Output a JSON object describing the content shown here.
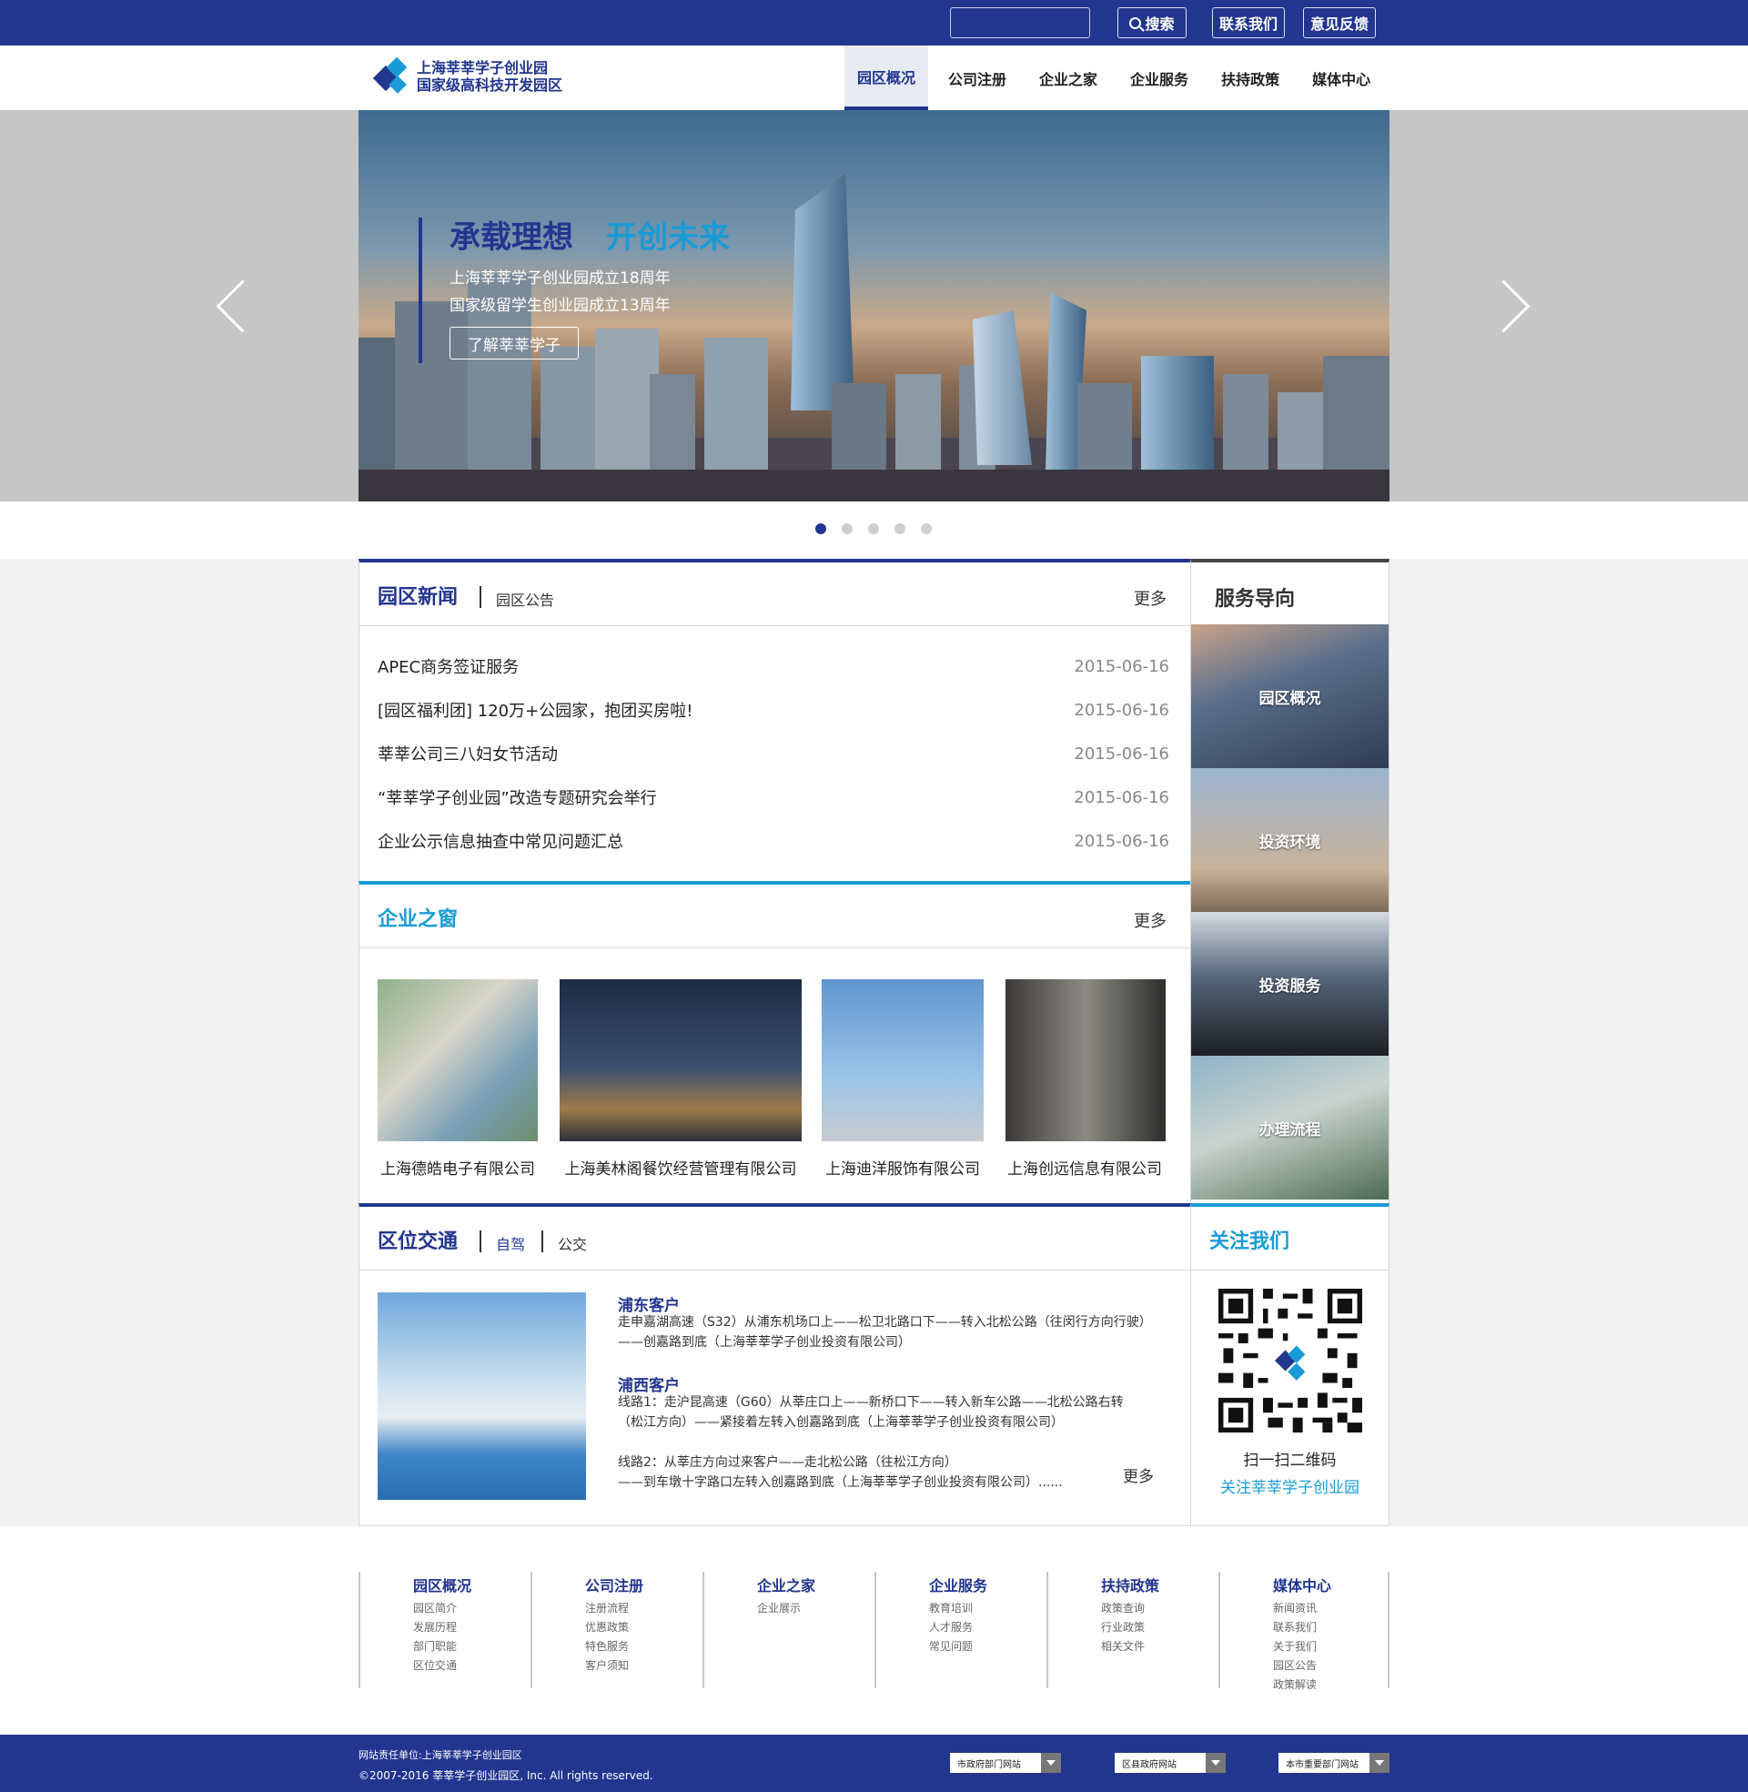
{
  "topbar": {
    "search_placeholder": "",
    "search_label": "搜索",
    "contact_label": "联系我们",
    "feedback_label": "意见反馈"
  },
  "logo": {
    "line1": "上海莘莘学子创业园",
    "line2": "国家级高科技开发园区"
  },
  "nav": {
    "items": [
      "园区概况",
      "公司注册",
      "企业之家",
      "企业服务",
      "扶持政策",
      "媒体中心"
    ],
    "active_index": 0
  },
  "banner": {
    "slogan_a": "承载理想",
    "slogan_b": "开创未来",
    "line1": "上海莘莘学子创业园成立18周年",
    "line2": "国家级留学生创业园成立13周年",
    "button": "了解莘莘学子",
    "slides": 5,
    "active_slide": 1
  },
  "news": {
    "title": "园区新闻",
    "tab2": "园区公告",
    "more": "更多",
    "items": [
      {
        "title": "APEC商务签证服务",
        "date": "2015-06-16"
      },
      {
        "title": "[园区福利团] 120万+公园家，抱团买房啦!",
        "date": "2015-06-16"
      },
      {
        "title": "莘莘公司三八妇女节活动",
        "date": "2015-06-16"
      },
      {
        "title": "“莘莘学子创业园”改造专题研究会举行",
        "date": "2015-06-16"
      },
      {
        "title": "企业公示信息抽查中常见问题汇总",
        "date": "2015-06-16"
      }
    ]
  },
  "window": {
    "title": "企业之窗",
    "more": "更多",
    "companies": [
      "上海德皓电子有限公司",
      "上海美林阁餐饮经营管理有限公司",
      "上海迪洋服饰有限公司",
      "上海创远信息有限公司"
    ]
  },
  "transport": {
    "title": "区位交通",
    "tab_drive": "自驾",
    "tab_bus": "公交",
    "more": "更多",
    "pudong_title": "浦东客户",
    "pudong_text": "走申嘉湖高速（S32）从浦东机场口上——松卫北路口下——转入北松公路（往闵行方向行驶）\n——创嘉路到底（上海莘莘学子创业投资有限公司）",
    "puxi_title": "浦西客户",
    "puxi_text1": "线路1：走沪昆高速（G60）从莘庄口上——新桥口下——转入新车公路——北松公路右转\n（松江方向）——紧接着左转入创嘉路到底（上海莘莘学子创业投资有限公司）",
    "puxi_text2": "线路2：从莘庄方向过来客户——走北松公路（往松江方向）\n——到车墩十字路口左转入创嘉路到底（上海莘莘学子创业投资有限公司）......"
  },
  "services": {
    "title": "服务导向",
    "tiles": [
      "园区概况",
      "投资环境",
      "投资服务",
      "办理流程"
    ]
  },
  "follow": {
    "title": "关注我们",
    "caption1": "扫一扫二维码",
    "caption2": "关注莘莘学子创业园"
  },
  "footer_links": [
    {
      "title": "园区概况",
      "items": [
        "园区简介",
        "发展历程",
        "部门职能",
        "区位交通"
      ]
    },
    {
      "title": "公司注册",
      "items": [
        "注册流程",
        "优惠政策",
        "特色服务",
        "客户须知"
      ]
    },
    {
      "title": "企业之家",
      "items": [
        "企业展示"
      ]
    },
    {
      "title": "企业服务",
      "items": [
        "教育培训",
        "人才服务",
        "常见问题"
      ]
    },
    {
      "title": "扶持政策",
      "items": [
        "政策查询",
        "行业政策",
        "相关文件"
      ]
    },
    {
      "title": "媒体中心",
      "items": [
        "新闻资讯",
        "联系我们",
        "关于我们",
        "园区公告",
        "政策解读"
      ]
    }
  ],
  "footer": {
    "owner": "网站责任单位:上海莘莘学子创业园区",
    "copyright": "©2007-2016 莘莘学子创业园区, Inc. All rights reserved.",
    "selects": [
      "市政府部门网站",
      "区县政府网站",
      "本市重要部门网站"
    ]
  },
  "colors": {
    "brand_blue": "#22358f",
    "accent_cyan": "#1a9bd7"
  }
}
